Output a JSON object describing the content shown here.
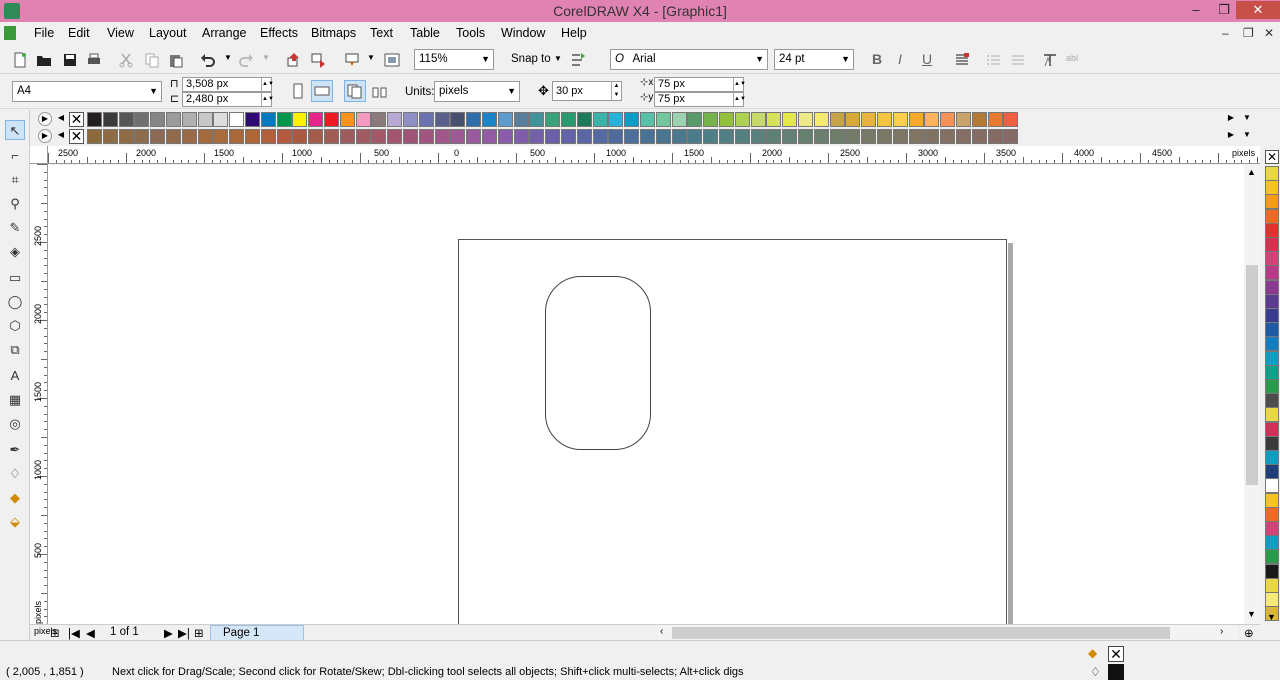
{
  "window": {
    "title": "CorelDRAW X4 - [Graphic1]",
    "minimize": "–",
    "restore": "❐",
    "close": "✕"
  },
  "menu": {
    "items": [
      "File",
      "Edit",
      "View",
      "Layout",
      "Arrange",
      "Effects",
      "Bitmaps",
      "Text",
      "Table",
      "Tools",
      "Window",
      "Help"
    ],
    "mdi_minimize": "–",
    "mdi_restore": "❐",
    "mdi_close": "✕"
  },
  "toolbar": {
    "zoom_level": "115%",
    "snap_to_label": "Snap to",
    "font_name": "Arial",
    "font_size": "24 pt"
  },
  "property_bar": {
    "page_size": "A4",
    "width": "3,508 px",
    "height": "2,480 px",
    "units_label": "Units:",
    "units_value": "pixels",
    "nudge": "30 px",
    "dup_x": "75 px",
    "dup_y": "75 px"
  },
  "palette": {
    "row1": [
      "#231f20",
      "#3b3b3b",
      "#575757",
      "#707070",
      "#858585",
      "#9b9b9b",
      "#b0b0b0",
      "#c7c7c7",
      "#dedede",
      "#ffffff",
      "#2e0a73",
      "#0079c1",
      "#00964b",
      "#fff200",
      "#e72489",
      "#ed1c24",
      "#f7931d",
      "#f49ac1",
      "#8a7a7a",
      "#b7a9d4",
      "#8f8fc6",
      "#6b72b0",
      "#5b5f8c",
      "#47506f",
      "#2f6dab",
      "#1b84c6",
      "#5e9ccd",
      "#5a7d9a",
      "#41929a",
      "#3aa27b",
      "#289a70",
      "#1e7b5a",
      "#38b5a8",
      "#2ab0d6",
      "#0a9bc8",
      "#57c0a7",
      "#74c69d",
      "#9bd3b0",
      "#5a9a6b",
      "#75b24a",
      "#93c13d",
      "#add253",
      "#c6d96b",
      "#d6e35a",
      "#e5e849",
      "#efe98d",
      "#f5ea6b",
      "#c6a34b",
      "#d8a83a",
      "#e8b341",
      "#f4c33f",
      "#f9d04d",
      "#f8a82b",
      "#fbb35d",
      "#f69157",
      "#c9a46a",
      "#b47a35",
      "#e67a30",
      "#f05f40"
    ],
    "row2": [
      "#8b6b3d",
      "#8d6b44",
      "#8e6c48",
      "#8d6b4f",
      "#8c6a53",
      "#926b4c",
      "#9b6a46",
      "#a3693f",
      "#a86b39",
      "#a9683a",
      "#b06537",
      "#b2603a",
      "#b45a3e",
      "#aa5a44",
      "#a45c4c",
      "#a05d55",
      "#9d5d5e",
      "#a25a63",
      "#a45868",
      "#a2566f",
      "#9f5476",
      "#a25580",
      "#a2578a",
      "#9f5995",
      "#9a5a9e",
      "#935ba4",
      "#8a5ca9",
      "#7f5dab",
      "#745fab",
      "#6a60aa",
      "#6263a8",
      "#5b66a6",
      "#5569a3",
      "#506c9f",
      "#4c6f9b",
      "#4a7297",
      "#497593",
      "#4a788f",
      "#4c7b8b",
      "#4f7e87",
      "#527f83",
      "#56807f",
      "#5a817b",
      "#5e8177",
      "#628073",
      "#668070",
      "#6a7f6d",
      "#6e7d6a",
      "#727c68",
      "#767a66",
      "#7a7865",
      "#7d7664",
      "#807463",
      "#827263",
      "#847063",
      "#856e63",
      "#866d64",
      "#866b65",
      "#866a66"
    ]
  },
  "toolbox": [
    "Pick",
    "Shape",
    "Crop",
    "Zoom",
    "Freehand",
    "Smart Fill",
    "Rectangle",
    "Ellipse",
    "Polygon",
    "Basic Shapes",
    "Text",
    "Table",
    "Interactive",
    "Eyedropper",
    "Outline",
    "Fill",
    "Interactive Fill"
  ],
  "ruler_h": [
    "2500",
    "2000",
    "1500",
    "1000",
    "500",
    "0",
    "500",
    "1000",
    "1500",
    "2000",
    "2500",
    "3000",
    "3500",
    "4000",
    "4500",
    "pixels"
  ],
  "ruler_v": [
    "2500",
    "2000",
    "1500",
    "1000",
    "500",
    "pixels"
  ],
  "page_navigator": {
    "counter": "1 of 1",
    "tab": "Page 1"
  },
  "right_palette": [
    "#e8d845",
    "#f5c422",
    "#f59a1b",
    "#ef6a24",
    "#e0322e",
    "#d62f4f",
    "#d0447a",
    "#b93a8a",
    "#8c3a8f",
    "#5b3b8e",
    "#3a3c8f",
    "#1f5ca5",
    "#157ec0",
    "#0e9dc3",
    "#0ca28a",
    "#2a9a4d",
    "#4d4d4d",
    "#e8d845",
    "#cf3158",
    "#3b3b3b",
    "#0e9dc3",
    "#1f3f7a",
    "#ffffff",
    "#f5c422",
    "#ef6a24",
    "#d0447a",
    "#0e9dc3",
    "#2a9a4d",
    "#1a1a1a",
    "#e8d845",
    "#f5e97a",
    "#d9b638"
  ],
  "status": {
    "coords": "( 2,005 , 1,851 )",
    "hint": "Next click for Drag/Scale; Second click for Rotate/Skew; Dbl-clicking tool selects all objects; Shift+click multi-selects; Alt+click digs"
  }
}
